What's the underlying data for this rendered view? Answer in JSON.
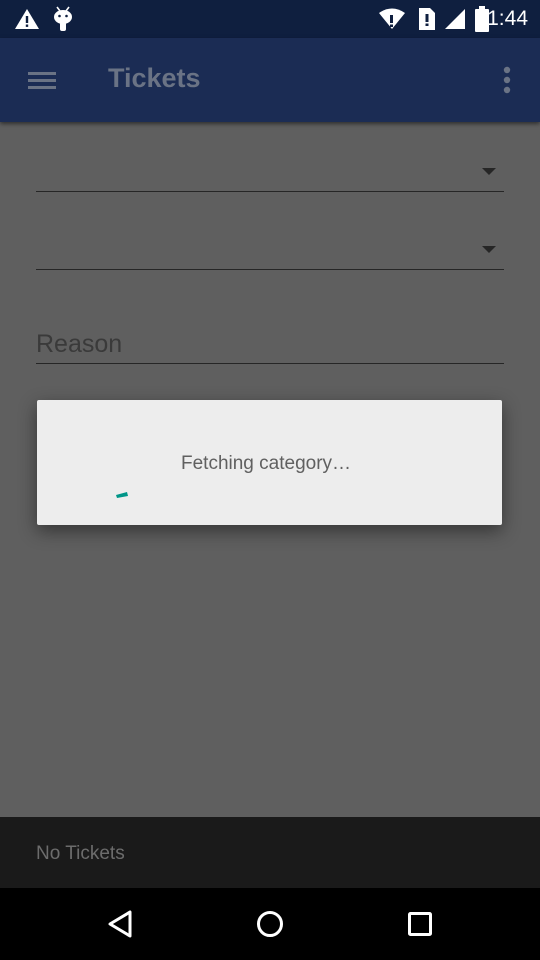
{
  "status_bar": {
    "time": "11:44",
    "icons": [
      "warning-icon",
      "android-icon",
      "wifi-icon",
      "sim-icon",
      "signal-icon",
      "battery-icon"
    ]
  },
  "app_bar": {
    "title": "Tickets",
    "menu_icon": "menu-icon",
    "overflow_icon": "more-vert-icon",
    "color": "#1b2c54"
  },
  "form": {
    "spinner_1_value": "",
    "spinner_2_value": "",
    "reason": {
      "placeholder": "Reason",
      "value": ""
    }
  },
  "dialog": {
    "message": "Fetching category…",
    "spinner_color": "#009688"
  },
  "bottom_bar": {
    "text": "No Tickets"
  },
  "nav_bar": {
    "icons": [
      "back-icon",
      "home-icon",
      "recents-icon"
    ]
  }
}
